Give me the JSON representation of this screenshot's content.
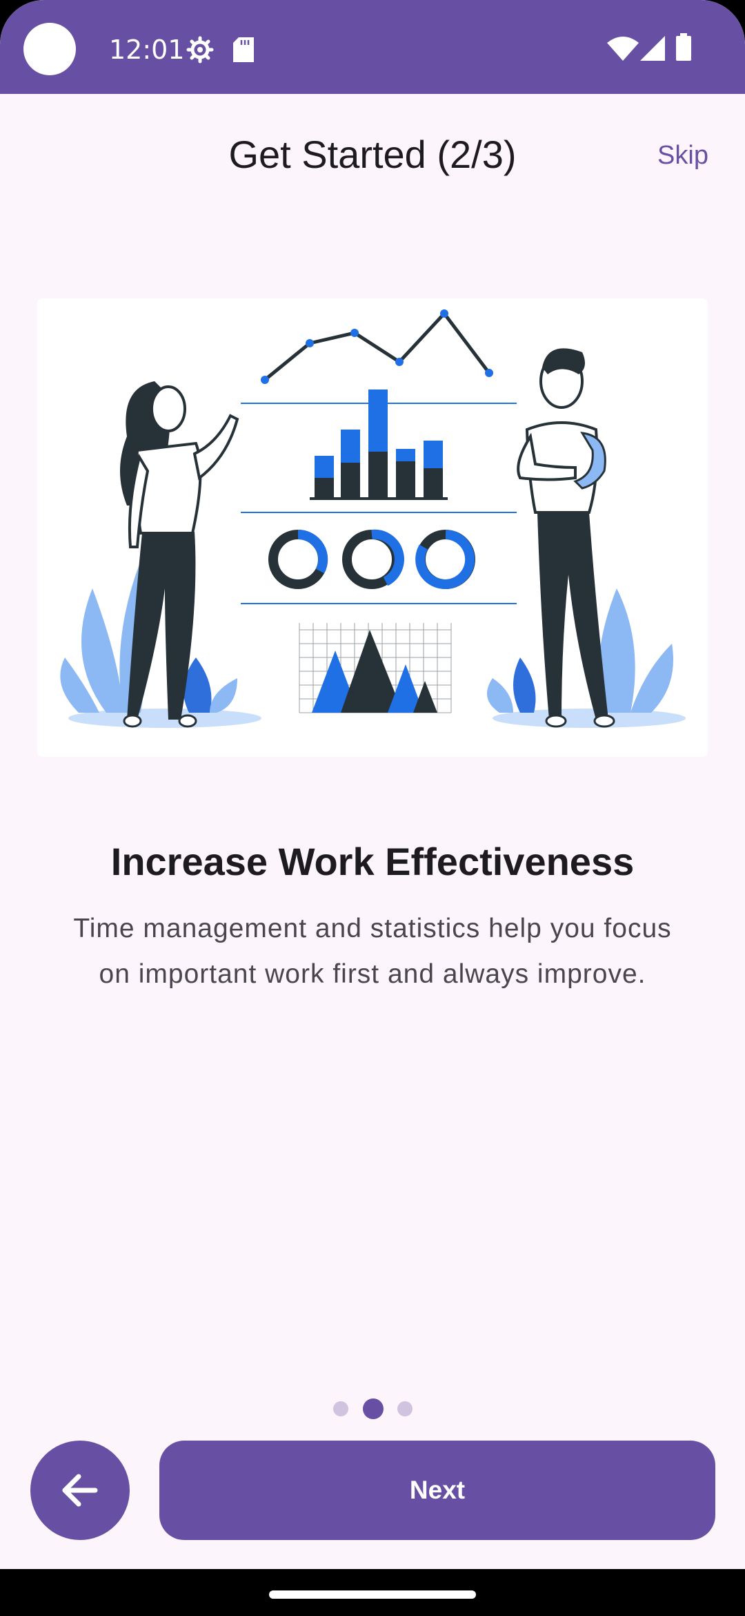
{
  "status_bar": {
    "time": "12:01",
    "icons": [
      "settings-icon",
      "sd-card-icon",
      "wifi-icon",
      "cellular-signal-icon",
      "battery-icon"
    ],
    "background_color": "#6750A4"
  },
  "header": {
    "title": "Get Started (2/3)",
    "skip_label": "Skip"
  },
  "illustration": {
    "description_icon": "work-effectiveness-illustration"
  },
  "content": {
    "heading": "Increase Work Effectiveness",
    "description_line1": "Time management and statistics help you focus",
    "description_line2": "on important work first and always improve."
  },
  "pager": {
    "total_pages": 3,
    "current_page": 2
  },
  "actions": {
    "back_icon": "arrow-back-icon",
    "next_label": "Next"
  },
  "colors": {
    "primary": "#6750A4",
    "background": "#FCF5FB",
    "dot_inactive": "#CFC3E0",
    "illustration_accent": "#1F6FE5",
    "illustration_light": "#8CB8F4"
  }
}
